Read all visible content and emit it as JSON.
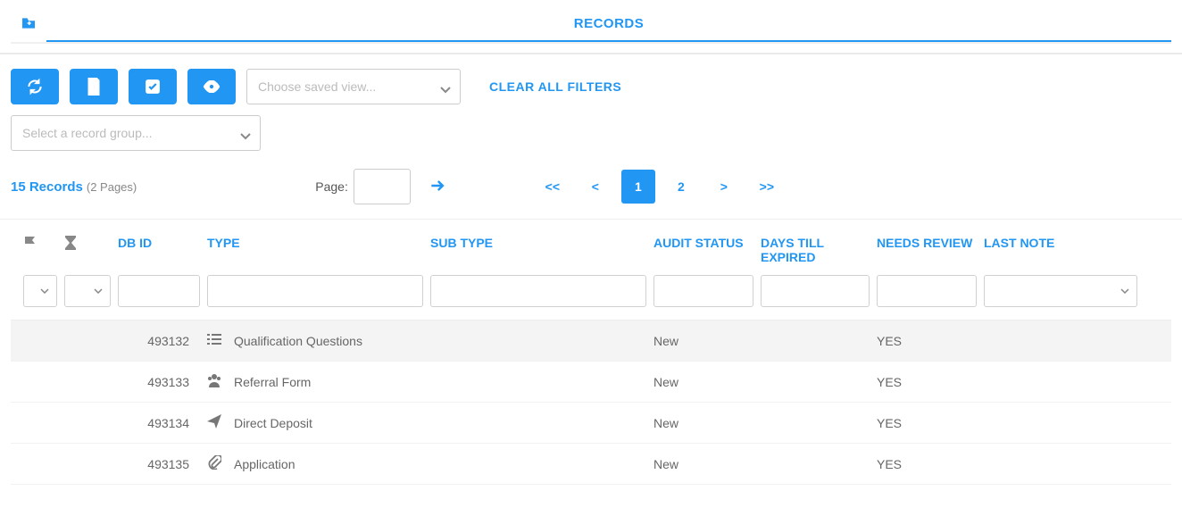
{
  "tabs": {
    "records_label": "RECORDS"
  },
  "toolbar": {
    "saved_view_placeholder": "Choose saved view...",
    "clear_filters_label": "CLEAR ALL FILTERS",
    "record_group_placeholder": "Select a record group..."
  },
  "pager": {
    "records_count": "15 Records",
    "pages_label": "(2 Pages)",
    "page_label": "Page:",
    "first": "<<",
    "prev": "<",
    "page1": "1",
    "page2": "2",
    "next": ">",
    "last": ">>"
  },
  "columns": {
    "dbid": "DB ID",
    "type": "TYPE",
    "subtype": "SUB TYPE",
    "audit": "AUDIT STATUS",
    "days": "DAYS TILL EXPIRED",
    "needs": "NEEDS REVIEW",
    "last": "LAST NOTE"
  },
  "rows": [
    {
      "dbid": "493132",
      "type": "Qualification Questions",
      "subtype": "",
      "audit": "New",
      "days": "",
      "needs": "YES",
      "last": "",
      "icon": "list"
    },
    {
      "dbid": "493133",
      "type": "Referral Form",
      "subtype": "",
      "audit": "New",
      "days": "",
      "needs": "YES",
      "last": "",
      "icon": "people"
    },
    {
      "dbid": "493134",
      "type": "Direct Deposit",
      "subtype": "",
      "audit": "New",
      "days": "",
      "needs": "YES",
      "last": "",
      "icon": "send"
    },
    {
      "dbid": "493135",
      "type": "Application",
      "subtype": "",
      "audit": "New",
      "days": "",
      "needs": "YES",
      "last": "",
      "icon": "clip"
    }
  ]
}
